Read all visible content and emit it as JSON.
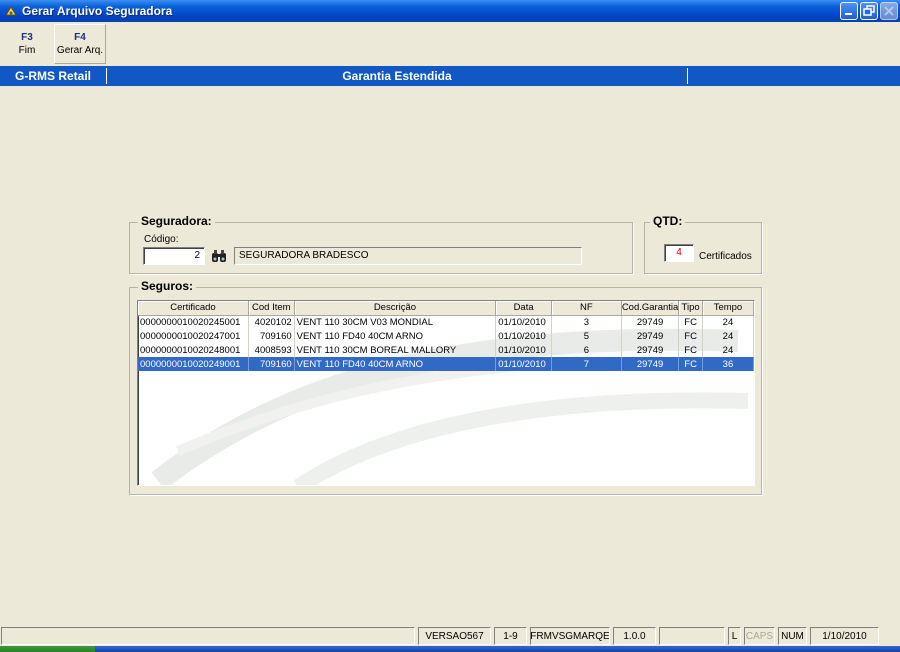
{
  "window": {
    "title": "Gerar Arquivo Seguradora"
  },
  "toolbar": [
    {
      "key": "F3",
      "label": "Fim"
    },
    {
      "key": "F4",
      "label": "Gerar Arq."
    }
  ],
  "header": {
    "app_name": "G-RMS Retail",
    "screen_title": "Garantia Estendida"
  },
  "seguradora": {
    "legend": "Seguradora:",
    "codigo_label": "Código:",
    "codigo_value": "2",
    "name_value": "SEGURADORA BRADESCO"
  },
  "qtd": {
    "legend": "QTD:",
    "value": "4",
    "unit_label": "Certificados",
    "value_color": "#d40000"
  },
  "seguros": {
    "legend": "Seguros:",
    "columns": [
      "Certificado",
      "Cod Item",
      "Descrição",
      "Data",
      "NF",
      "Cod.Garantia",
      "Tipo",
      "Tempo"
    ],
    "rows": [
      [
        "0000000010020245001",
        "4020102",
        "VENT 110 30CM V03 MONDIAL",
        "01/10/2010",
        "3",
        "29749",
        "FC",
        "24"
      ],
      [
        "0000000010020247001",
        "709160",
        "VENT 110 FD40 40CM ARNO",
        "01/10/2010",
        "5",
        "29749",
        "FC",
        "24"
      ],
      [
        "0000000010020248001",
        "4008593",
        "VENT 110 30CM BOREAL MALLORY",
        "01/10/2010",
        "6",
        "29749",
        "FC",
        "24"
      ],
      [
        "0000000010020249001",
        "709160",
        "VENT 110 FD40 40CM ARNO",
        "01/10/2010",
        "7",
        "29749",
        "FC",
        "36"
      ]
    ],
    "selected_row": 3
  },
  "statusbar": {
    "version": "VERSAO567",
    "range": "1-9",
    "form": "FRMVSGMARQE",
    "build": "1.0.0",
    "lock": "L",
    "caps": "CAPS",
    "num": "NUM",
    "date": "1/10/2010"
  },
  "colors": {
    "accent": "#1258c4",
    "selection": "#316ac5",
    "background": "#ece9d8"
  }
}
